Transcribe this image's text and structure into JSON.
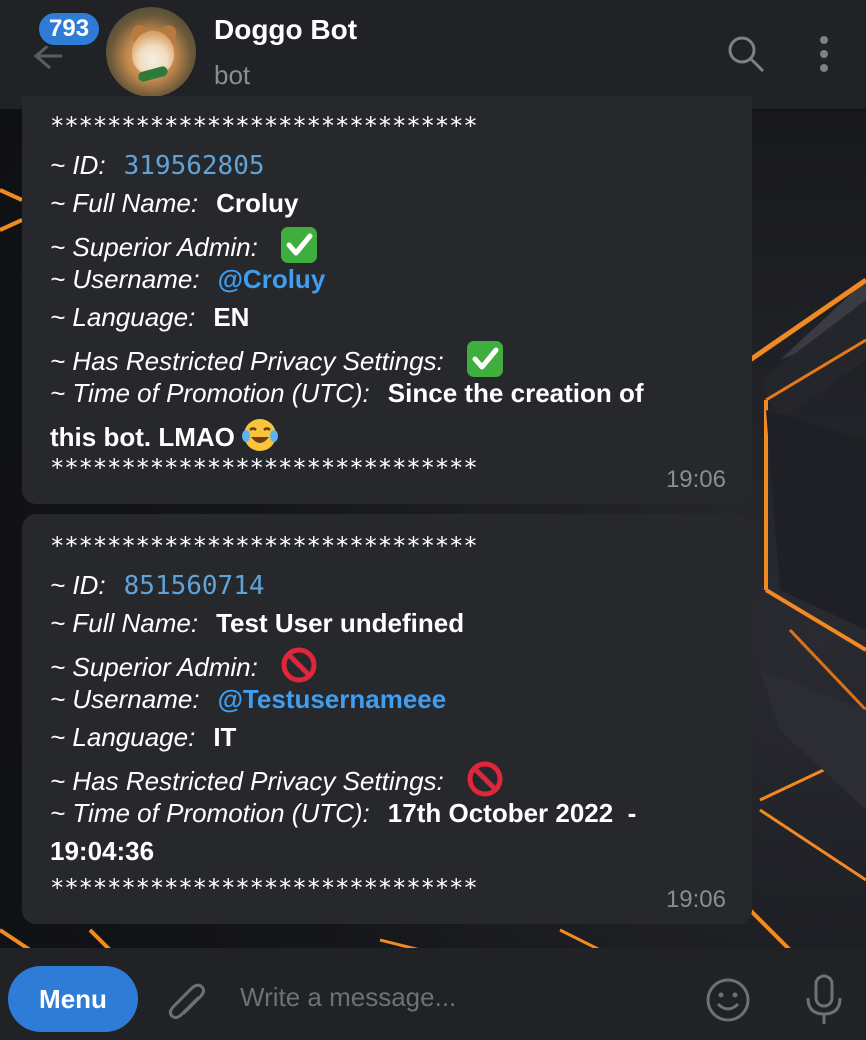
{
  "header": {
    "unread_count": "793",
    "title": "Doggo Bot",
    "subtitle": "bot"
  },
  "messages": [
    {
      "stars": "******************************",
      "id_label": "~ ID:",
      "id_value": "319562805",
      "full_name_label": "~ Full Name:",
      "full_name_value": "Croluy",
      "superior_admin_label": "~ Superior Admin:",
      "superior_admin_icon": "check-mark-emoji",
      "username_label": "~ Username:",
      "username_value": "@Croluy",
      "language_label": "~ Language:",
      "language_value": "EN",
      "privacy_label": "~ Has Restricted Privacy Settings:",
      "privacy_icon": "check-mark-emoji",
      "promotion_label": "~ Time of Promotion (UTC):",
      "promotion_value_line1": "Since the creation of",
      "promotion_value_line2": "this bot. LMAO",
      "promotion_emoji": "laughing-tears-emoji",
      "stars_end": "******************************",
      "time": "19:06"
    },
    {
      "stars": "******************************",
      "id_label": "~ ID:",
      "id_value": "851560714",
      "full_name_label": "~ Full Name:",
      "full_name_value": "Test User undefined",
      "superior_admin_label": "~ Superior Admin:",
      "superior_admin_icon": "prohibited-emoji",
      "username_label": "~ Username:",
      "username_value": "@Testusernameee",
      "language_label": "~ Language:",
      "language_value": "IT",
      "privacy_label": "~ Has Restricted Privacy Settings:",
      "privacy_icon": "prohibited-emoji",
      "promotion_label": "~ Time of Promotion (UTC):",
      "promotion_value_line1": "17th October 2022  -",
      "promotion_value_line2": "19:04:36",
      "stars_end": "******************************",
      "time": "19:06"
    }
  ],
  "composer": {
    "menu_label": "Menu",
    "placeholder": "Write a message..."
  },
  "colors": {
    "accent": "#2f7cd6",
    "link": "#3f9ef0",
    "bubble": "#26282c",
    "header": "#202226",
    "check_green": "#3fae3f",
    "prohibit_red": "#e0263a"
  }
}
